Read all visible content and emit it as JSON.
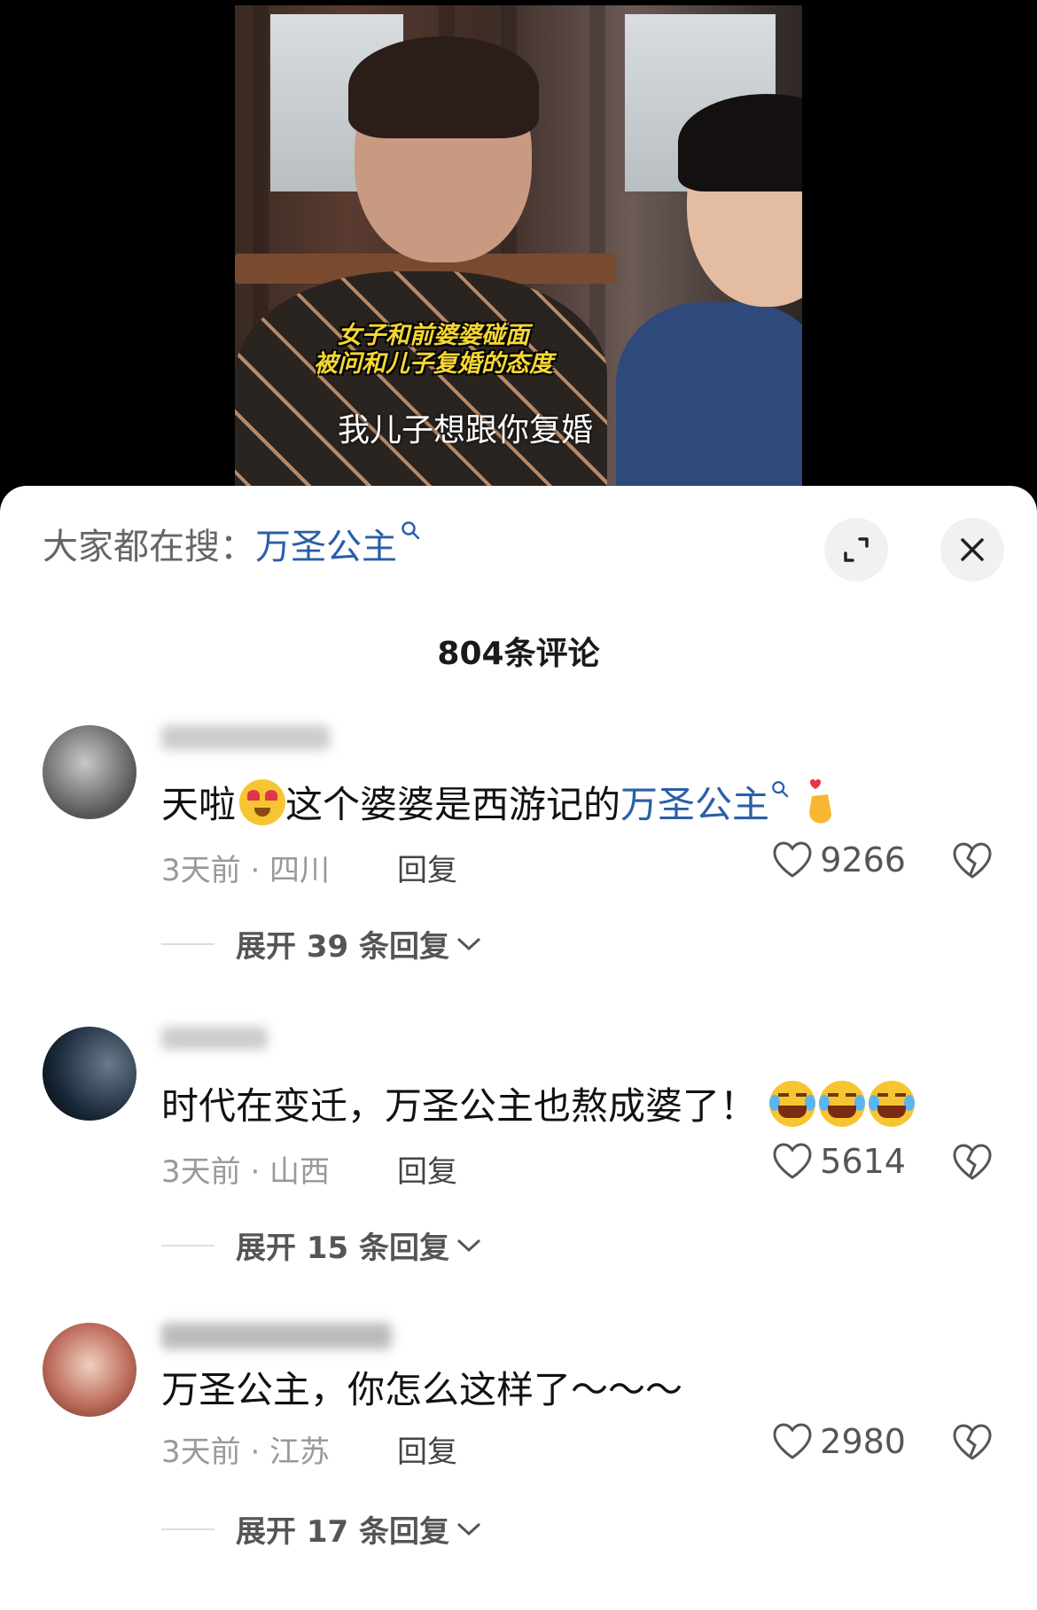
{
  "video": {
    "caption_line1": "女子和前婆婆碰面",
    "caption_line2": "被问和儿子复婚的态度",
    "subtitle": "我儿子想跟你复婚"
  },
  "sheet": {
    "search_prefix": "大家都在搜：",
    "search_term": "万圣公主",
    "comment_count_label": "804条评论"
  },
  "comments": [
    {
      "text_before": "天啦",
      "text_mid": "这个婆婆是西游记的",
      "highlight": "万圣公主",
      "meta": "3天前 · 四川",
      "reply_label": "回复",
      "likes": "9266",
      "expand_label": "展开 39 条回复"
    },
    {
      "text": "时代在变迁，万圣公主也熬成婆了！",
      "meta": "3天前 · 山西",
      "reply_label": "回复",
      "likes": "5614",
      "expand_label": "展开 15 条回复"
    },
    {
      "text": "万圣公主，你怎么这样了～～～",
      "meta": "3天前 · 江苏",
      "reply_label": "回复",
      "likes": "2980",
      "expand_label": "展开 17 条回复"
    }
  ],
  "colors": {
    "link": "#2a5ea8",
    "sheet_bg": "#ffffff"
  },
  "icons": [
    "search-icon",
    "expand-icon",
    "close-icon",
    "heart-icon",
    "broken-heart-icon",
    "chevron-down-icon"
  ]
}
